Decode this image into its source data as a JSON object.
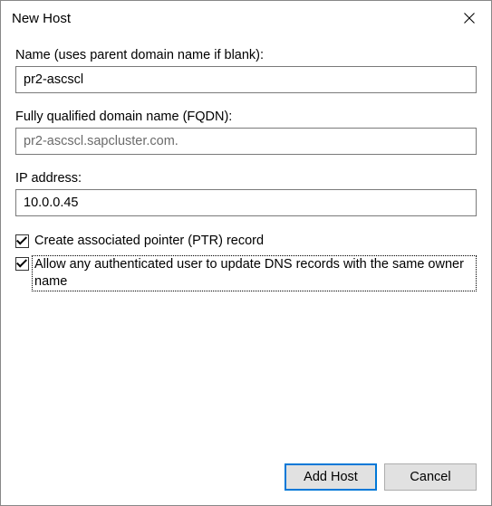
{
  "dialog": {
    "title": "New Host"
  },
  "fields": {
    "name": {
      "label": "Name (uses parent domain name if blank):",
      "value": "pr2-ascscl"
    },
    "fqdn": {
      "label": "Fully qualified domain name (FQDN):",
      "value": "pr2-ascscl.sapcluster.com."
    },
    "ip": {
      "label": "IP address:",
      "value": "10.0.0.45"
    }
  },
  "checkboxes": {
    "ptr": {
      "label": "Create associated pointer (PTR) record",
      "checked": true
    },
    "allow_update": {
      "label": "Allow any authenticated user to update DNS records with the same owner name",
      "checked": true
    }
  },
  "buttons": {
    "add_host": "Add Host",
    "cancel": "Cancel"
  }
}
